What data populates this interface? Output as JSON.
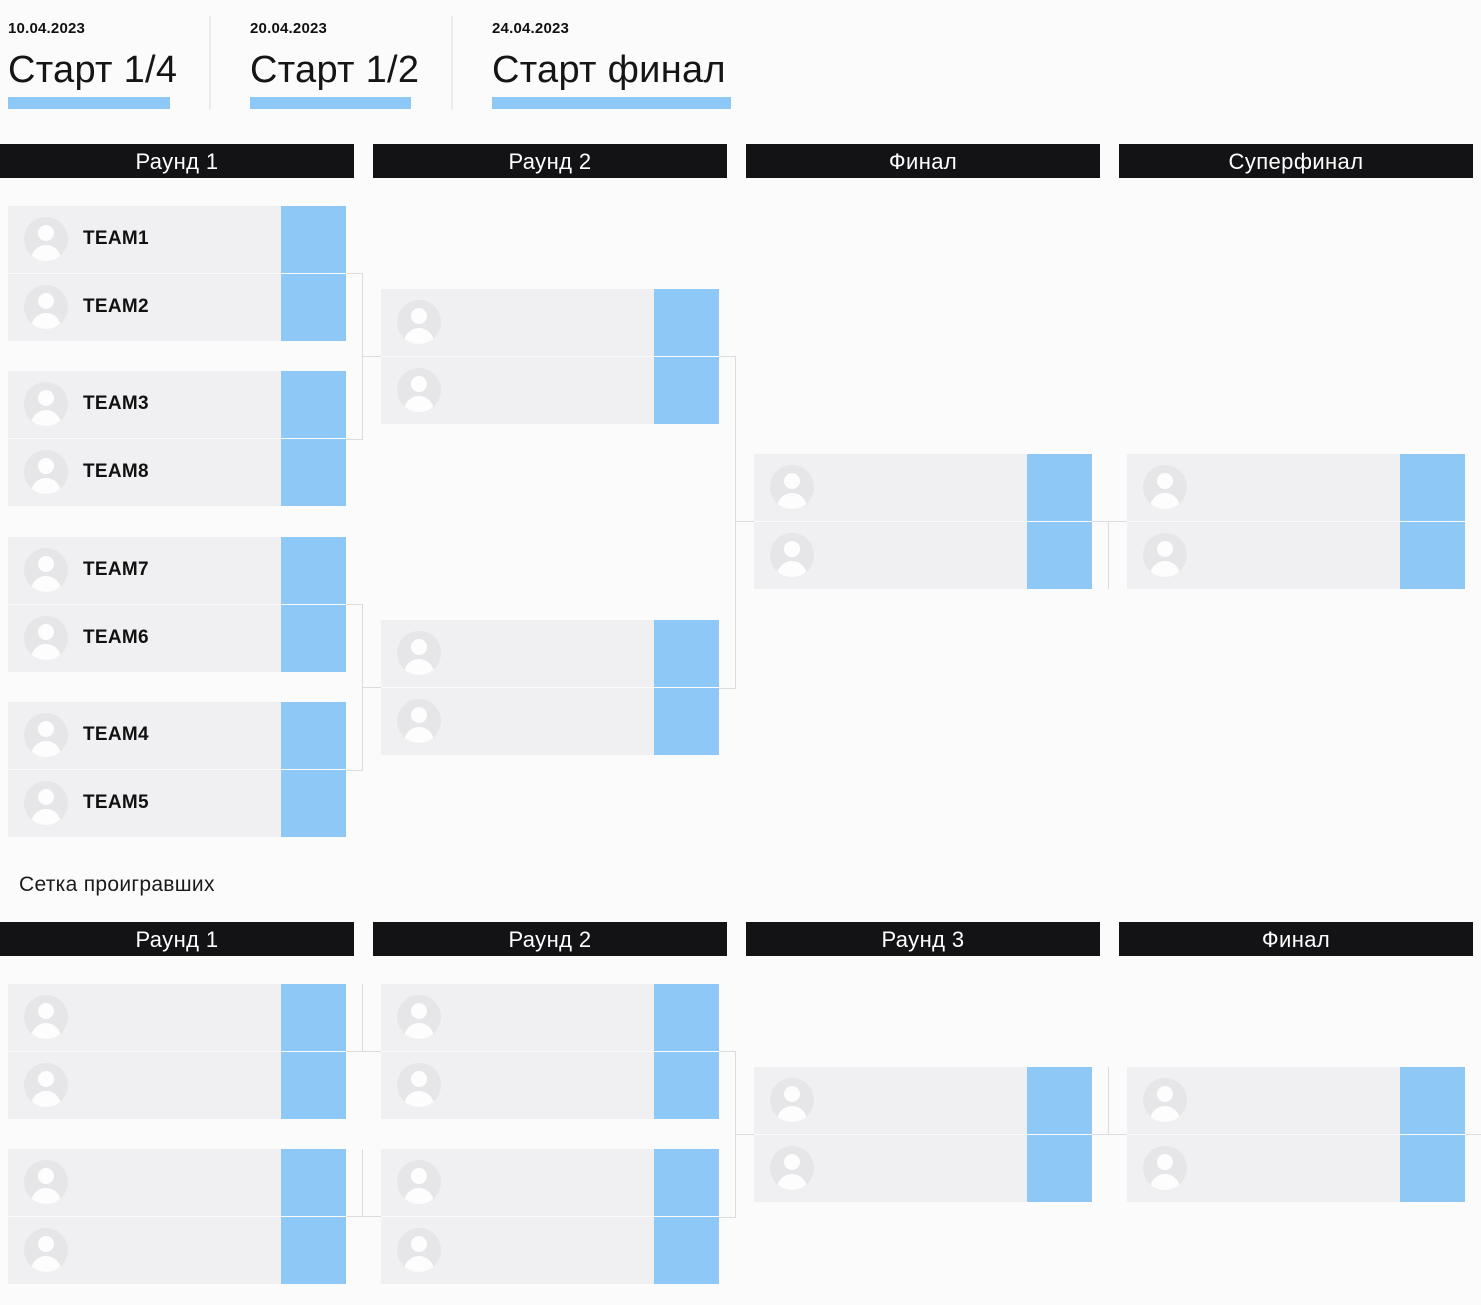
{
  "stages": [
    {
      "date": "10.04.2023",
      "title": "Старт 1/4"
    },
    {
      "date": "20.04.2023",
      "title": "Старт 1/2"
    },
    {
      "date": "24.04.2023",
      "title": "Старт финал"
    }
  ],
  "upper_bracket": {
    "rounds": [
      "Раунд 1",
      "Раунд 2",
      "Финал",
      "Суперфинал"
    ],
    "round1_matches": [
      {
        "team_a": "TEAM1",
        "team_b": "TEAM2"
      },
      {
        "team_a": "TEAM3",
        "team_b": "TEAM8"
      },
      {
        "team_a": "TEAM7",
        "team_b": "TEAM6"
      },
      {
        "team_a": "TEAM4",
        "team_b": "TEAM5"
      }
    ]
  },
  "lower_bracket": {
    "caption": "Сетка проигравших",
    "rounds": [
      "Раунд 1",
      "Раунд 2",
      "Раунд 3",
      "Финал"
    ]
  },
  "colors": {
    "header_bg": "#131316",
    "score_cell": "#8ec8f6",
    "slot_bg": "#f0f0f2",
    "accent_underline": "#8ec8f6"
  }
}
